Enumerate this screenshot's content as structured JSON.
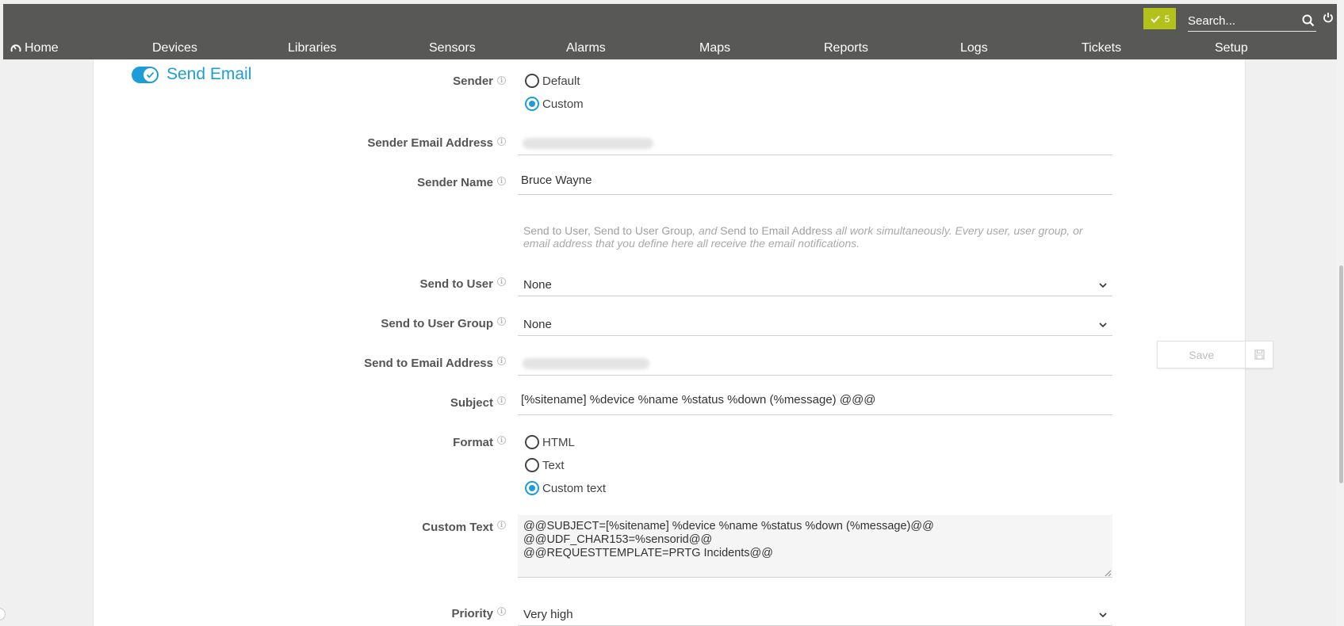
{
  "topbar": {
    "badge_count": "5",
    "search_placeholder": "Search...",
    "accent": "#b2c21a"
  },
  "nav": {
    "items": [
      {
        "label": "Home"
      },
      {
        "label": "Devices"
      },
      {
        "label": "Libraries"
      },
      {
        "label": "Sensors"
      },
      {
        "label": "Alarms"
      },
      {
        "label": "Maps"
      },
      {
        "label": "Reports"
      },
      {
        "label": "Logs"
      },
      {
        "label": "Tickets"
      },
      {
        "label": "Setup"
      }
    ]
  },
  "section": {
    "title": "Send Email",
    "toggle_on": true,
    "accent": "#1d9dd8"
  },
  "form": {
    "sender": {
      "label": "Sender",
      "options": [
        "Default",
        "Custom"
      ],
      "selected": "Custom"
    },
    "sender_email": {
      "label": "Sender Email Address",
      "value": ""
    },
    "sender_name": {
      "label": "Sender Name",
      "value": "Bruce Wayne"
    },
    "hint": {
      "part1": "Send to User",
      "sep1": ", ",
      "part2": "Send to User Group",
      "sep2": ", and ",
      "part3": "Send to Email Address",
      "rest": " all work simultaneously. Every user, user group, or email address that you define here all receive the email notifications."
    },
    "send_to_user": {
      "label": "Send to User",
      "value": "None"
    },
    "send_to_user_group": {
      "label": "Send to User Group",
      "value": "None"
    },
    "send_to_email": {
      "label": "Send to Email Address",
      "value": ""
    },
    "subject": {
      "label": "Subject",
      "value": "[%sitename] %device %name %status %down (%message) @@@"
    },
    "format": {
      "label": "Format",
      "options": [
        "HTML",
        "Text",
        "Custom text"
      ],
      "selected": "Custom text"
    },
    "custom_text": {
      "label": "Custom Text",
      "value": "@@SUBJECT=[%sitename] %device %name %status %down (%message)@@\n@@UDF_CHAR153=%sensorid@@\n@@REQUESTTEMPLATE=PRTG Incidents@@"
    },
    "priority": {
      "label": "Priority",
      "value": "Very high"
    }
  },
  "save": {
    "label": "Save"
  }
}
